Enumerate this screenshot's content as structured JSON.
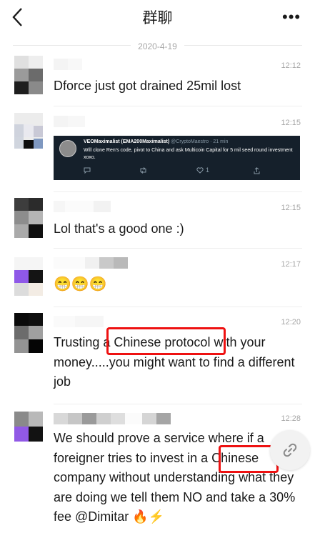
{
  "header": {
    "title": "群聊",
    "more_label": "•••"
  },
  "date_divider": "2020-4-19",
  "messages": [
    {
      "time": "12:12",
      "text": "Dforce just got drained 25mil lost"
    },
    {
      "time": "12:15",
      "text": ""
    },
    {
      "time": "12:15",
      "text": "Lol that's a good one :)"
    },
    {
      "time": "12:17",
      "text": "😁😁😁"
    },
    {
      "time": "12:20",
      "text": "Trusting a Chinese protocol with your money.....you might want to find a different job"
    },
    {
      "time": "12:28",
      "text": "We should prove a service where if a foreigner tries to invest in a Chinese company without understanding what they are doing we tell them NO and take a 30% fee @Dimitar 🔥⚡"
    }
  ],
  "tweet": {
    "author": "VEOMaximalist (EMA200Maximalist)",
    "handle_time": "@CryptoMaestro · 21 min",
    "body": "Will clone Ren's code, pivot to China and ask Multicoin Capital for 5 mil seed round investment xoxo.",
    "reply_icon": "comment-icon",
    "retweet_icon": "retweet-icon",
    "like_icon": "heart-icon",
    "like_count": "1",
    "share_icon": "share-icon"
  },
  "colors": {
    "highlight": "#ee1111",
    "tweet_bg": "#15202b"
  }
}
